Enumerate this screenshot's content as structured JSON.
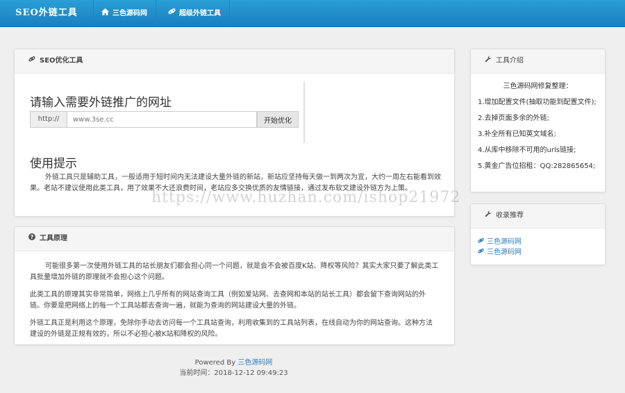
{
  "navbar": {
    "brand": "SEO外链工具",
    "links": [
      {
        "label": "三色源码网",
        "icon": "home-icon"
      },
      {
        "label": "超级外链工具",
        "icon": "link-icon"
      }
    ]
  },
  "seo_panel": {
    "heading": "SEO优化工具",
    "url_title": "请输入需要外链推广的网址",
    "addon": "http://",
    "placeholder": "www.3se.cc",
    "button": "开始优化",
    "tip_title": "使用提示",
    "tip_text": "外链工具只是辅助工具，一般适用于短时间内无法建设大量外链的新站，新站应坚持每天做一到两次为宜，大约一周左右能看到效果。老站不建议使用此类工具，用了效果不大还浪费时间，老站应多交换优质的友情链接，通过发布软文建设外链方为上策。"
  },
  "principle_panel": {
    "heading": "工具原理",
    "paragraphs": [
      "可能很多第一次使用外链工具的站长朋友们都会担心同一个问题，就是会不会被百度K站、降权等风险？其实大家只要了解此类工具批量增加外链的原理就不会担心这个问题。",
      "此类工具的原理其实非常简单，网络上几乎所有的网站查询工具（例如爱站网、去查网和本站的站长工具）都会留下查询网站的外链。你要是把网络上的每一个工具站都去查询一遍，就能为查询的网站建设大量的外链。",
      "外链工具正是利用这个原理，免除你手动去访问每一个工具站查询，利用收集到的工具站列表，在线自动为你的网站查询。这种方法建设的外链是正规有效的，所以不必担心被K站和降权的风险。"
    ]
  },
  "intro_panel": {
    "heading": "工具介绍",
    "lines": [
      "三色源码网修复整理：",
      "1.增加配置文件(抽取功能到配置文件);",
      "2.去掉页面多余的外链;",
      "3.补全所有已知英文域名;",
      "4.从库中移除不可用的urls链接;",
      "5.黄金广告位招租：QQ:282865654;"
    ]
  },
  "recommend_panel": {
    "heading": "收录推荐",
    "links": [
      "三色源码网",
      "三色源码网"
    ]
  },
  "footer": {
    "powered_prefix": "Powered By",
    "powered_link": "三色源码网",
    "time_label": "当前时间：",
    "time_value": "2018-12-12 09:49:23"
  },
  "watermark": "https://www.huzhan.com/ishop21972",
  "colors": {
    "navbar": "#2a9fd6",
    "link": "#2a7fbf",
    "background": "#efefef"
  }
}
